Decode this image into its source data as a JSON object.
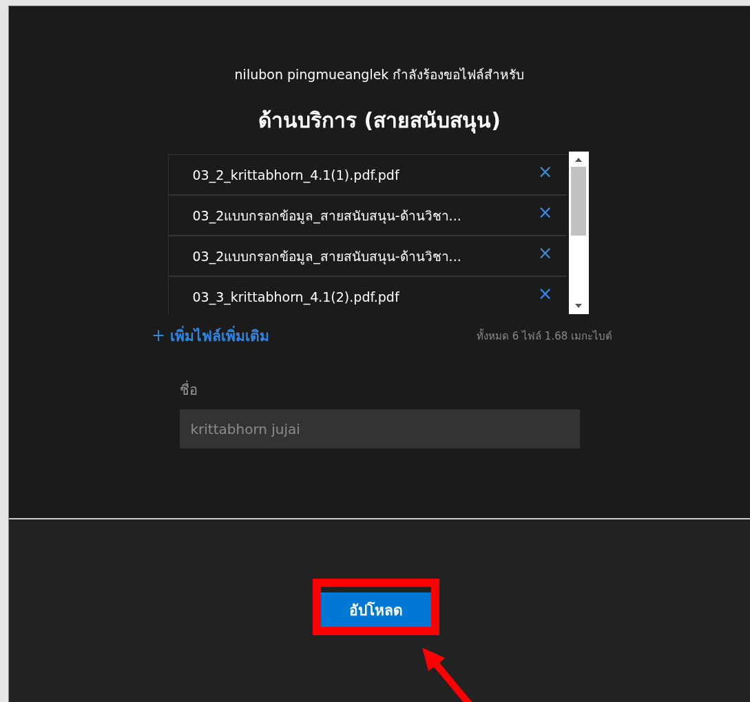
{
  "request_text": "nilubon pingmueanglek กำลังร้องขอไฟล์สำหรับ",
  "title": "ด้านบริการ (สายสนับสนุน)",
  "files": [
    {
      "name": "03_2_krittabhorn_4.1(1).pdf.pdf",
      "remove": "×"
    },
    {
      "name": "03_2แบบกรอกข้อมูล_สายสนับสนุน-ด้านวิชา...",
      "remove": "×"
    },
    {
      "name": "03_2แบบกรอกข้อมูล_สายสนับสนุน-ด้านวิชา...",
      "remove": "×"
    },
    {
      "name": "03_3_krittabhorn_4.1(2).pdf.pdf",
      "remove": "×"
    }
  ],
  "add_more": {
    "icon": "+",
    "label": "เพิ่มไฟล์เพิ่มเติม"
  },
  "total": "ทั้งหมด 6 ไฟล์  1.68 เมกะไบต์",
  "name_field": {
    "label": "ชื่อ",
    "value": "krittabhorn jujai",
    "disabled": true
  },
  "upload_button": "อัปโหลด"
}
